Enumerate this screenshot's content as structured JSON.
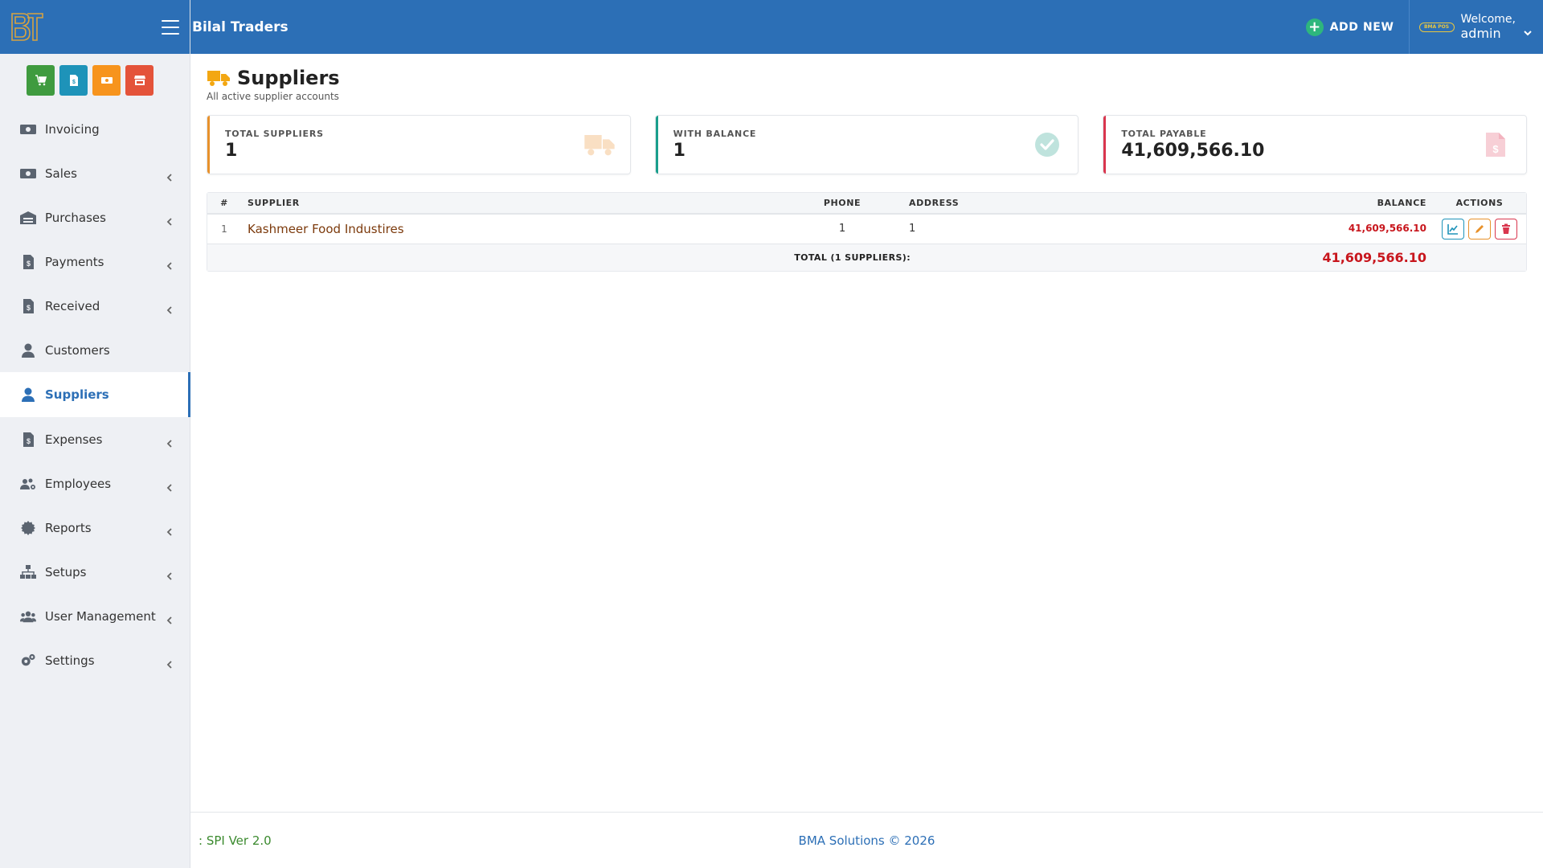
{
  "app": {
    "title": "Bilal Traders",
    "logo_text": "BT"
  },
  "topbar": {
    "add_new_label": "ADD NEW",
    "badge_text": "BMA POS",
    "welcome": "Welcome,",
    "username": "admin"
  },
  "quick_actions": [
    {
      "icon": "cart-icon",
      "color": "#3f9b3f"
    },
    {
      "icon": "invoice-icon",
      "color": "#1e93b9"
    },
    {
      "icon": "money-icon",
      "color": "#f7941d"
    },
    {
      "icon": "store-icon",
      "color": "#e4533a"
    }
  ],
  "sidebar": {
    "items": [
      {
        "label": "Invoicing",
        "icon": "money-icon",
        "has_submenu": false
      },
      {
        "label": "Sales",
        "icon": "money-icon",
        "has_submenu": true
      },
      {
        "label": "Purchases",
        "icon": "warehouse-icon",
        "has_submenu": true
      },
      {
        "label": "Payments",
        "icon": "invoice-icon",
        "has_submenu": true
      },
      {
        "label": "Received",
        "icon": "invoice-icon",
        "has_submenu": true
      },
      {
        "label": "Customers",
        "icon": "user-icon",
        "has_submenu": false
      },
      {
        "label": "Suppliers",
        "icon": "user-icon",
        "has_submenu": false,
        "active": true
      },
      {
        "label": "Expenses",
        "icon": "invoice-icon",
        "has_submenu": true
      },
      {
        "label": "Employees",
        "icon": "users-gear-icon",
        "has_submenu": true
      },
      {
        "label": "Reports",
        "icon": "cog-badge-icon",
        "has_submenu": true
      },
      {
        "label": "Setups",
        "icon": "sitemap-icon",
        "has_submenu": true
      },
      {
        "label": "User Management",
        "icon": "users-icon",
        "has_submenu": true
      },
      {
        "label": "Settings",
        "icon": "cogs-icon",
        "has_submenu": true
      }
    ]
  },
  "page": {
    "title": "Suppliers",
    "subtitle": "All active supplier accounts"
  },
  "cards": [
    {
      "label": "TOTAL SUPPLIERS",
      "value": "1",
      "accent": "#e8912b",
      "icon": "truck-icon"
    },
    {
      "label": "WITH BALANCE",
      "value": "1",
      "accent": "#1a9e8c",
      "icon": "check-circle-icon"
    },
    {
      "label": "TOTAL PAYABLE",
      "value": "41,609,566.10",
      "accent": "#d9364e",
      "icon": "invoice-dollar-icon"
    }
  ],
  "table": {
    "headers": {
      "num": "#",
      "supplier": "SUPPLIER",
      "phone": "PHONE",
      "address": "ADDRESS",
      "balance": "BALANCE",
      "actions": "ACTIONS"
    },
    "rows": [
      {
        "num": "1",
        "supplier": "Kashmeer Food Industires",
        "phone": "1",
        "address": "1",
        "balance": "41,609,566.10"
      }
    ],
    "total_label": "TOTAL (1 SUPPLIERS):",
    "total_value": "41,609,566.10"
  },
  "footer": {
    "version": ": SPI Ver 2.0",
    "copyright": "BMA Solutions © 2026"
  },
  "colors": {
    "brand": "#2c6fb6",
    "balance": "#c8161d",
    "supplier_link": "#7c3a0c"
  }
}
